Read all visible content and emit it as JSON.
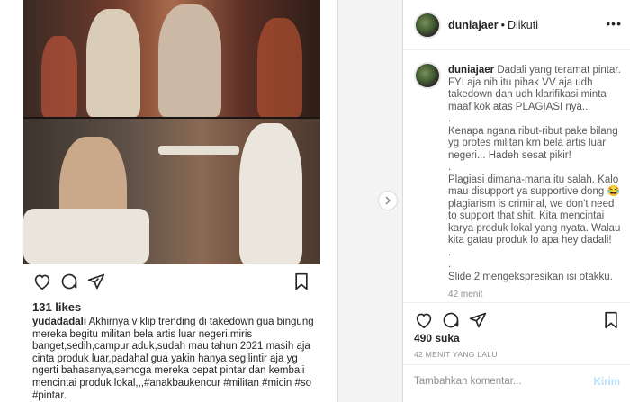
{
  "post": {
    "likes": "131 likes",
    "caption_user": "yudadadali",
    "caption_text": "Akhirnya v klip trending di takedown  gua bingung mereka begitu militan bela artis luar negeri,miris banget,sedih,campur aduk,sudah mau tahun 2021 masih aja cinta produk luar,padahal gua yakin hanya segilintir aja yg ngerti bahasanya,semoga mereka cepat pintar dan kembali mencintai produk lokal,,,#anakbaukencur #militan #micin #so #pintar."
  },
  "header": {
    "username": "duniajaer",
    "separator": "•",
    "follow_status": "Diikuti",
    "more": "•••"
  },
  "comment": {
    "username": "duniajaer",
    "text": "Dadali yang teramat pintar.\nFYI aja nih itu pihak VV aja udh takedown dan udh klarifikasi minta maaf kok atas PLAGIASI nya..\n.\nKenapa ngana ribut-ribut pake bilang yg protes militan krn bela artis luar negeri... Hadeh sesat pikir!\n.\nPlagiasi dimana-mana itu salah. Kalo mau disupport ya supportive dong 😂 plagiarism is criminal, we don't need to support that shit. Kita mencintai karya produk lokal yang nyata. Walau kita gatau produk lo apa hey dadali!\n.\n.\nSlide 2 mengekspresikan isi otakku.",
    "time": "42 menit"
  },
  "footer": {
    "likes": "490 suka",
    "time": "42 MENIT YANG LALU",
    "comment_placeholder": "Tambahkan komentar...",
    "send_label": "Kirim"
  },
  "icons": {
    "heart": "heart-icon",
    "comment": "comment-icon",
    "share": "share-icon",
    "bookmark": "bookmark-icon",
    "next": "chevron-right-icon"
  }
}
